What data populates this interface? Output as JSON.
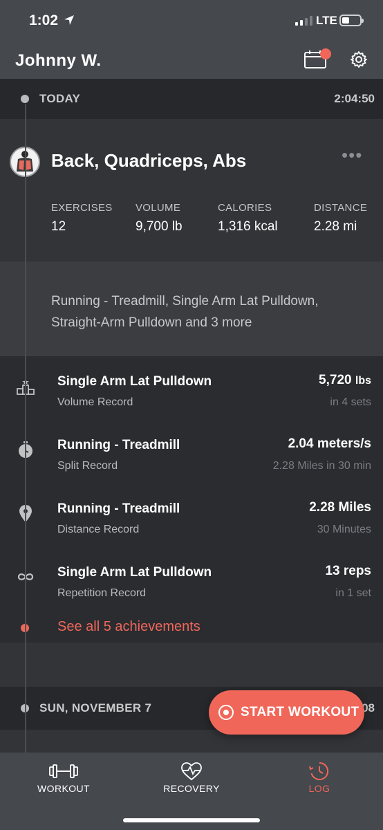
{
  "status": {
    "time": "1:02",
    "network": "LTE"
  },
  "header": {
    "user_name": "Johnny  W."
  },
  "today": {
    "label": "TODAY",
    "time": "2:04:50"
  },
  "workout": {
    "title": "Back, Quadriceps, Abs",
    "stats": [
      {
        "label": "EXERCISES",
        "value": "12"
      },
      {
        "label": "VOLUME",
        "value": "9,700 lb"
      },
      {
        "label": "CALORIES",
        "value": "1,316 kcal"
      },
      {
        "label": "DISTANCE",
        "value": "2.28 mi"
      }
    ],
    "exercise_summary": "Running - Treadmill, Single Arm Lat Pulldown, Straight-Arm Pulldown and 3 more"
  },
  "achievements": [
    {
      "title": "Single Arm Lat Pulldown",
      "subtitle": "Volume Record",
      "value": "5,720",
      "unit": "lbs",
      "detail": "in 4 sets",
      "icon": "podium-icon"
    },
    {
      "title": "Running - Treadmill",
      "subtitle": "Split Record",
      "value": "2.04 meters/s",
      "unit": "",
      "detail": "2.28 Miles in 30 min",
      "icon": "stopwatch-icon"
    },
    {
      "title": "Running - Treadmill",
      "subtitle": "Distance Record",
      "value": "2.28 Miles",
      "unit": "",
      "detail": "30 Minutes",
      "icon": "location-pin-icon"
    },
    {
      "title": "Single Arm Lat Pulldown",
      "subtitle": "Repetition Record",
      "value": "13 reps",
      "unit": "",
      "detail": "in 1 set",
      "icon": "infinity-icon"
    }
  ],
  "see_all": "See all 5 achievements",
  "previous_day": {
    "label": "SUN, NOVEMBER 7",
    "time_partial": "08"
  },
  "start_button": {
    "label": "START WORKOUT"
  },
  "tabs": [
    {
      "label": "WORKOUT",
      "icon": "dumbbell-icon",
      "active": false
    },
    {
      "label": "RECOVERY",
      "icon": "heart-pulse-icon",
      "active": false
    },
    {
      "label": "LOG",
      "icon": "log-clock-icon",
      "active": true
    }
  ],
  "colors": {
    "accent": "#f0675a",
    "background": "#2f3135",
    "header": "#45484d"
  }
}
